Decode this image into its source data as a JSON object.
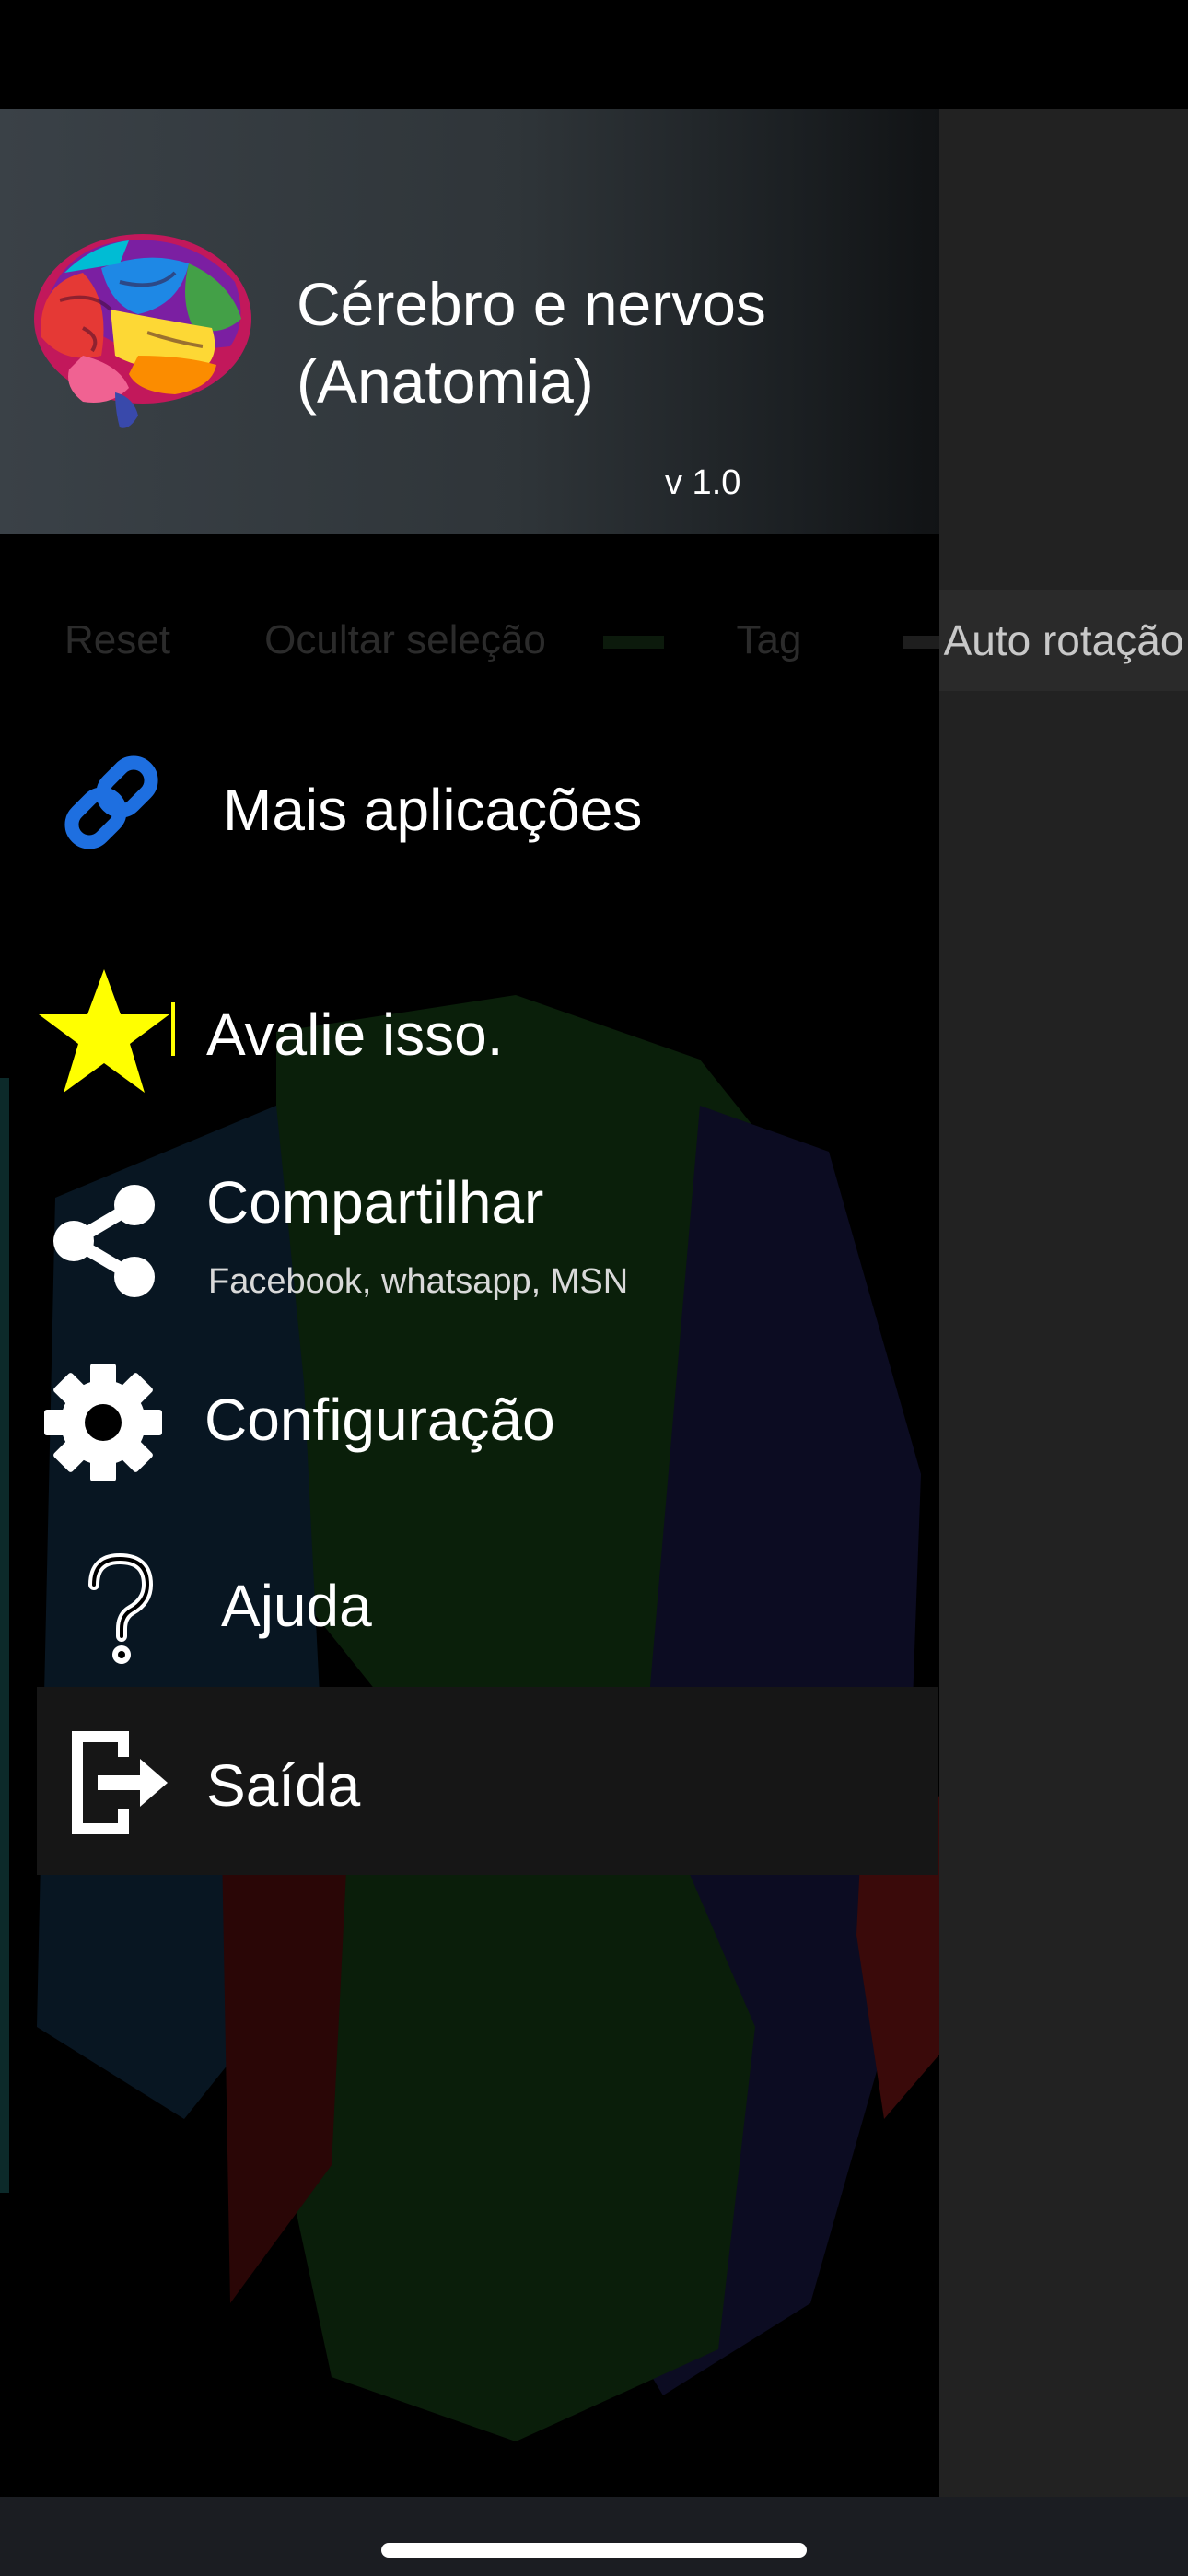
{
  "app": {
    "title": "Cérebro e nervos (Anatomia)",
    "version": "v 1.0"
  },
  "toolbar": {
    "reset_label": "Reset",
    "hide_selection_label": "Ocultar seleção",
    "tag_label": "Tag",
    "auto_rotation_label": "Auto rotação"
  },
  "menu": {
    "more_apps": {
      "label": "Mais aplicações",
      "icon": "link-icon"
    },
    "rate": {
      "label": "Avalie isso.",
      "icon": "star-icon"
    },
    "share": {
      "label": "Compartilhar",
      "sublabel": "Facebook, whatsapp, MSN",
      "icon": "share-icon"
    },
    "settings": {
      "label": "Configuração",
      "icon": "gear-icon"
    },
    "help": {
      "label": "Ajuda",
      "icon": "question-icon"
    },
    "exit": {
      "label": "Saída",
      "icon": "exit-icon"
    }
  },
  "colors": {
    "link_icon": "#1e6fe0",
    "star_icon": "#ffff00",
    "drawer_header": "#353b40",
    "selected_row": "#161616",
    "right_panel": "#222222"
  }
}
